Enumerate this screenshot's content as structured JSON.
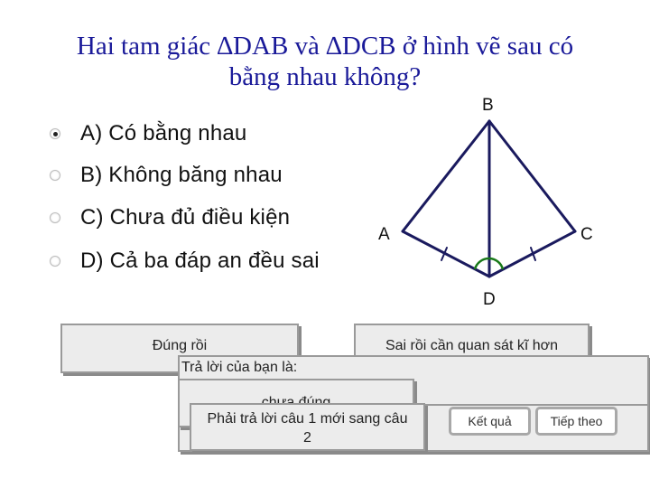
{
  "question": {
    "line1": "Hai tam giác ∆DAB và ∆DCB ở hình vẽ sau có",
    "line2": "bằng nhau không?"
  },
  "options": [
    {
      "label": "A) Có bằng nhau",
      "selected": true
    },
    {
      "label": "B) Không băng nhau",
      "selected": false
    },
    {
      "label": "C) Chưa đủ điều kiện",
      "selected": false
    },
    {
      "label": "D) Cả ba đáp an đều sai",
      "selected": false
    }
  ],
  "figure": {
    "vertices": {
      "A": "A",
      "B": "B",
      "C": "C",
      "D": "D"
    },
    "line_color": "#1a1a5e",
    "angle_mark_color": "#1a7a1a"
  },
  "feedback": {
    "correct": "Đúng rồi",
    "incorrect": "Sai rồi cần quan sát kĩ hơn",
    "your_answer_label": "Trả lời của bạn là:",
    "answer_status": "chưa đúng",
    "must_answer_msg_line1": "Phải trả lời câu 1 mới sang câu",
    "must_answer_msg_line2": "2"
  },
  "buttons": {
    "result": "Kết quả",
    "next": "Tiếp theo"
  }
}
